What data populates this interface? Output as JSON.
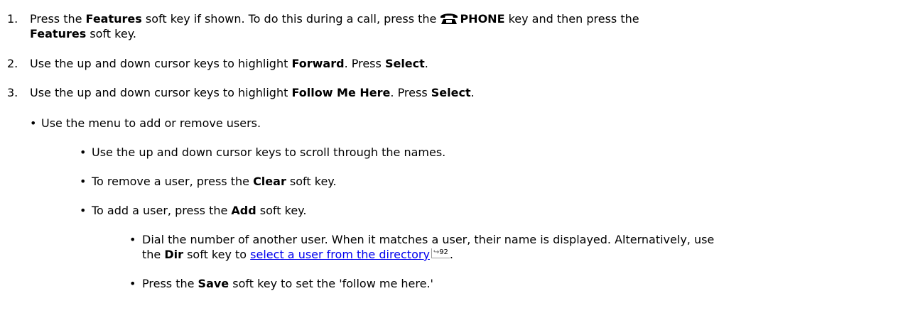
{
  "steps": [
    {
      "number": "1.",
      "line1": {
        "t1": "Press the ",
        "b1": "Features",
        "t2": " soft key if shown. To do this during a call, press the ",
        "b2": "PHONE",
        "t3": " key and then press the"
      },
      "line2": {
        "b1": "Features",
        "t1": " soft key."
      }
    },
    {
      "number": "2.",
      "t1": "Use the up and down cursor keys to highlight ",
      "b1": "Forward",
      "t2": ". Press ",
      "b2": "Select",
      "t3": "."
    },
    {
      "number": "3.",
      "t1": "Use the up and down cursor keys to highlight ",
      "b1": "Follow Me Here",
      "t2": ". Press ",
      "b2": "Select",
      "t3": "."
    }
  ],
  "bullets": {
    "menu": "Use the menu to add or remove users.",
    "scroll": "Use the up and down cursor keys to scroll through the names.",
    "remove": {
      "t1": "To remove a user, press the ",
      "b1": "Clear",
      "t2": " soft key."
    },
    "add": {
      "t1": "To add a user, press the ",
      "b1": "Add",
      "t2": " soft key."
    },
    "dial": {
      "line1": "Dial the number of another user. When it matches a user, their name is displayed.  Alternatively, use",
      "t1": "the ",
      "b1": "Dir",
      "t2": " soft key to ",
      "link": "select a user from the directory",
      "page_ref": "92",
      "t3": "."
    },
    "save": {
      "t1": "Press the ",
      "b1": "Save",
      "t2": " soft key to set the 'follow me here.'"
    }
  },
  "icons": {
    "phone": "phone-icon",
    "page_ref_arrow": "page-reference-arrow-icon"
  },
  "colors": {
    "link": "#0000ee",
    "text": "#000000"
  }
}
